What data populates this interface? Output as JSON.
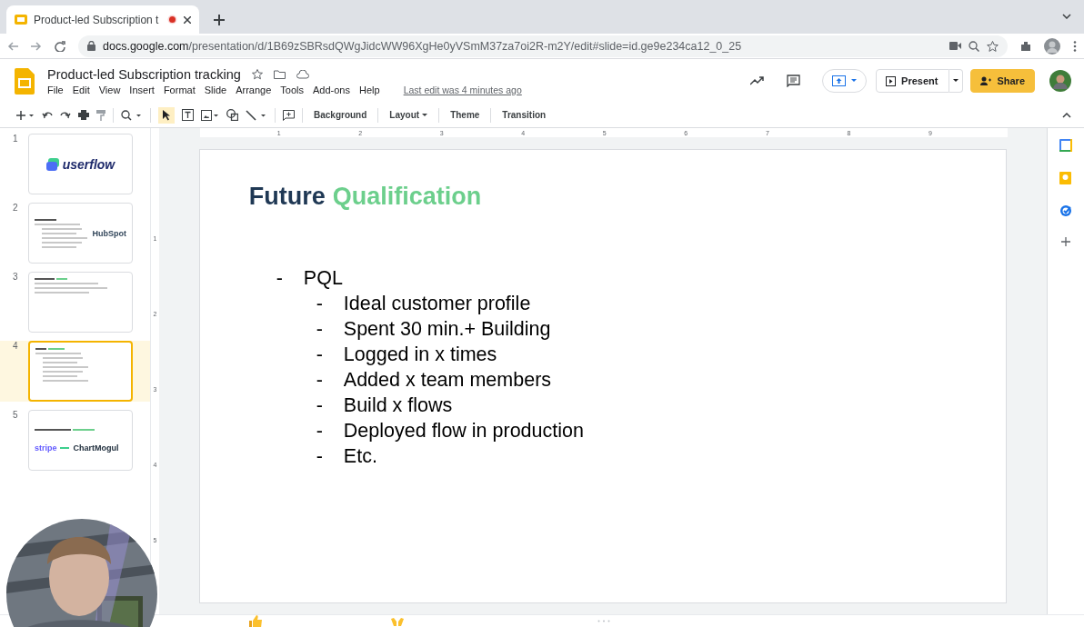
{
  "browser": {
    "tab": {
      "title": "Product-led Subscription t",
      "recording": true
    },
    "url_host": "docs.google.com",
    "url_path": "/presentation/d/1B69zSBRsdQWgJidcWW96XgHe0yVSmM37za7oi2R-m2Y/edit#slide=id.ge9e234ca12_0_25"
  },
  "document": {
    "title": "Product-led Subscription tracking",
    "menu": [
      "File",
      "Edit",
      "View",
      "Insert",
      "Format",
      "Slide",
      "Arrange",
      "Tools",
      "Add-ons",
      "Help"
    ],
    "last_edit": "Last edit was 4 minutes ago"
  },
  "header_buttons": {
    "present": "Present",
    "share": "Share"
  },
  "toolbar": {
    "buttons": [
      {
        "label": "Background",
        "caret": false
      },
      {
        "label": "Layout",
        "caret": true
      },
      {
        "label": "Theme",
        "caret": false
      },
      {
        "label": "Transition",
        "caret": false
      }
    ]
  },
  "ruler": {
    "horizontal": [
      "1",
      "2",
      "3",
      "4",
      "5",
      "6",
      "7",
      "8",
      "9"
    ],
    "vertical": [
      "1",
      "2",
      "3",
      "4",
      "5"
    ]
  },
  "slides": [
    {
      "number": "1",
      "selected": false,
      "kind": "logo",
      "logos": [
        "userflow"
      ]
    },
    {
      "number": "2",
      "selected": false,
      "kind": "list_logo",
      "logos": [
        "HubSpot"
      ]
    },
    {
      "number": "3",
      "selected": false,
      "kind": "text"
    },
    {
      "number": "4",
      "selected": true,
      "kind": "list"
    },
    {
      "number": "5",
      "selected": false,
      "kind": "two_logos",
      "logos": [
        "stripe",
        "ChartMogul"
      ]
    }
  ],
  "slide": {
    "title": "Future",
    "title_highlight": "Qualification",
    "bullets": [
      {
        "bullet": "-",
        "text": "PQL",
        "children": [
          {
            "bullet": "-",
            "text": "Ideal customer profile"
          },
          {
            "bullet": "-",
            "text": "Spent 30 min.+ Building"
          },
          {
            "bullet": "-",
            "text": "Logged in x times"
          },
          {
            "bullet": "-",
            "text": "Added x team members"
          },
          {
            "bullet": "-",
            "text": "Build x flows"
          },
          {
            "bullet": "-",
            "text": "Deployed flow in production"
          },
          {
            "bullet": "-",
            "text": "Etc."
          }
        ]
      }
    ]
  }
}
